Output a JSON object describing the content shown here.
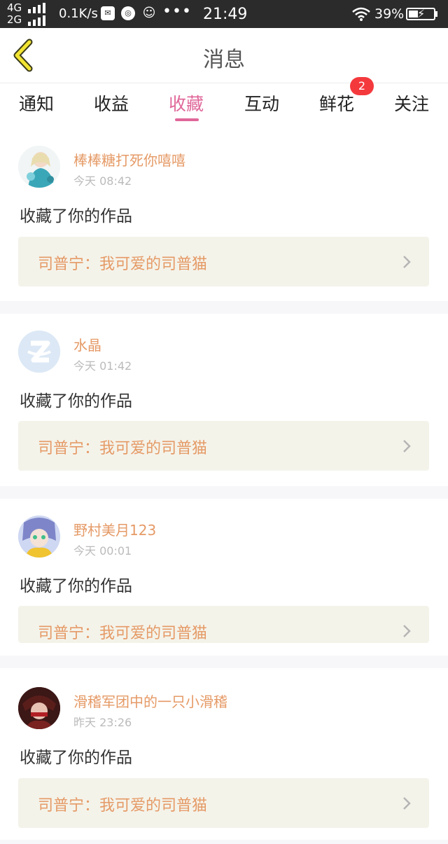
{
  "status_bar": {
    "net_top": "4G",
    "net_bottom": "2G",
    "speed": "0.1K/s",
    "time": "21:49",
    "battery": "39%",
    "dots": "•••"
  },
  "header": {
    "title": "消息"
  },
  "tabs": [
    {
      "label": "通知"
    },
    {
      "label": "收益"
    },
    {
      "label": "收藏"
    },
    {
      "label": "互动"
    },
    {
      "label": "鲜花"
    },
    {
      "label": "关注"
    }
  ],
  "active_tab": "收藏",
  "flower_badge": "2",
  "items": [
    {
      "user": "棒棒糖打死你嘻嘻",
      "time": "今天 08:42",
      "action": "收藏了你的作品",
      "work": "司普宁：我可爱的司普猫"
    },
    {
      "user": "水晶",
      "time": "今天 01:42",
      "action": "收藏了你的作品",
      "work": "司普宁：我可爱的司普猫"
    },
    {
      "user": "野村美月123",
      "time": "今天 00:01",
      "action": "收藏了你的作品",
      "work": "司普宁：我可爱的司普猫"
    },
    {
      "user": "滑稽军团中的一只小滑稽",
      "time": "昨天 23:26",
      "action": "收藏了你的作品",
      "work": "司普宁：我可爱的司普猫"
    }
  ],
  "colors": {
    "accent": "#e0679a",
    "username": "#e59a66",
    "badge": "#f4393d",
    "card_bg": "#f4f3ea"
  },
  "icons": [
    "back-icon",
    "chevron-right-icon",
    "wifi-icon",
    "battery-icon",
    "signal-icon"
  ]
}
